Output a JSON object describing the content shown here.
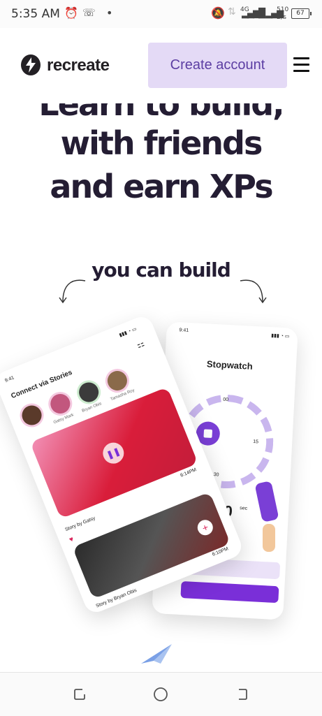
{
  "status_bar": {
    "time": "5:35 AM",
    "network": "4G",
    "speed_value": "510",
    "speed_unit": "B/s",
    "battery": "67"
  },
  "header": {
    "brand_name": "recreate",
    "create_account_label": "Create account"
  },
  "hero": {
    "headline_line0": "Learn to build,",
    "headline_line1": "with friends",
    "headline_line2": "and earn XPs",
    "subheading": "you can build"
  },
  "phone_stories": {
    "time": "9:41",
    "title": "Connect via Stories",
    "story_names": [
      "Gatsy Mark",
      "Bryan Obis",
      "Tamasha Roy"
    ],
    "post1_time": "6:14PM",
    "post1_caption": "Story by Gatsy",
    "post2_time": "6:10PM",
    "post2_caption": "Story by Bryan Obis"
  },
  "phone_stopwatch": {
    "time": "9:41",
    "title": "Stopwatch",
    "dial_top": "00",
    "dial_right": "15",
    "dial_bottom": "30",
    "timer": ": 00",
    "timer_unit": "sec"
  },
  "colors": {
    "accent": "#7a2fd8",
    "button_bg": "#e4daf6",
    "button_text": "#5c3ea3",
    "headline": "#241d33"
  }
}
